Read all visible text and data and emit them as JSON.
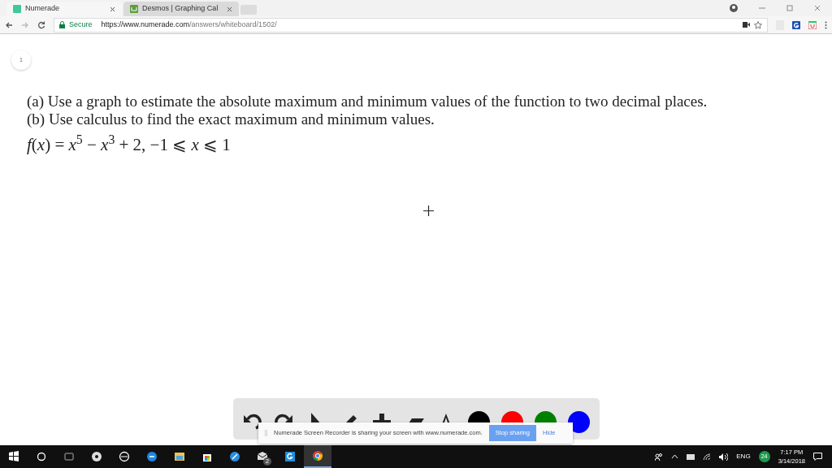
{
  "browser": {
    "tabs": [
      {
        "title": "Numerade",
        "selected": true
      },
      {
        "title": "Desmos | Graphing Cal",
        "selected": false
      }
    ],
    "secure_label": "Secure",
    "url_host": "https://www.numerade.com",
    "url_path": "/answers/whiteboard/1502/"
  },
  "page": {
    "page_number": "1",
    "question": [
      "(a) Use a graph to estimate the absolute maximum and minimum values of the function to two decimal places.",
      "(b) Use calculus to find the exact maximum and minimum values."
    ],
    "formula": "*f*(*x*) = *x*$^{5}$ − *x*$^{3}$ + 2, −1 ⩽ *x* ⩽ 1"
  },
  "toolbar": {
    "colors": [
      {
        "color": "#000000"
      },
      {
        "color": "#ff0000"
      },
      {
        "color": "#008000"
      },
      {
        "color": "#0000ff"
      }
    ]
  },
  "share_banner": {
    "message": "Numerade Screen Recorder is sharing your screen with www.numerade.com.",
    "stop_button": "Stop sharing",
    "hide_link": "Hide"
  },
  "taskbar": {
    "mail_count": "2",
    "language": "ENG",
    "notification_count": "24",
    "time": "7:17 PM",
    "date": "3/14/2018"
  }
}
